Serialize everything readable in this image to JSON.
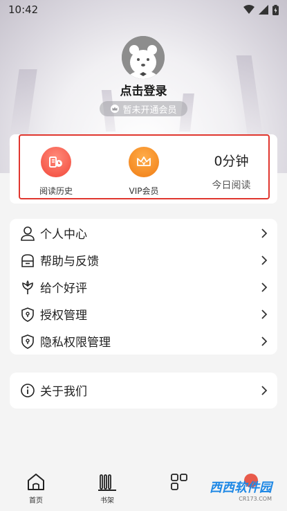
{
  "status_bar": {
    "time": "10:42"
  },
  "profile": {
    "login_text": "点击登录",
    "vip_status": "暂未开通会员"
  },
  "stats": {
    "history_label": "阅读历史",
    "vip_label": "VIP会员",
    "minutes": "0分钟",
    "today_label": "今日阅读"
  },
  "menu": {
    "items": [
      {
        "label": "个人中心",
        "icon": "person-icon"
      },
      {
        "label": "帮助与反馈",
        "icon": "mailbox-icon"
      },
      {
        "label": "给个好评",
        "icon": "flower-icon"
      },
      {
        "label": "授权管理",
        "icon": "shield-icon"
      },
      {
        "label": "隐私权限管理",
        "icon": "shield-icon"
      }
    ]
  },
  "about": {
    "label": "关于我们",
    "icon": "info-icon"
  },
  "tabbar": {
    "tabs": [
      {
        "label": "首页",
        "icon": "home-icon"
      },
      {
        "label": "书架",
        "icon": "bookshelf-icon"
      },
      {
        "label": "",
        "icon": "grid-icon"
      },
      {
        "label": "",
        "icon": "profile-icon"
      }
    ]
  },
  "watermark": {
    "brand": "西西软件园",
    "site": "CR173.COM"
  },
  "colors": {
    "accent_red": "#f35a4a",
    "accent_orange": "#f58a1f",
    "outline_red": "#e0362e"
  }
}
